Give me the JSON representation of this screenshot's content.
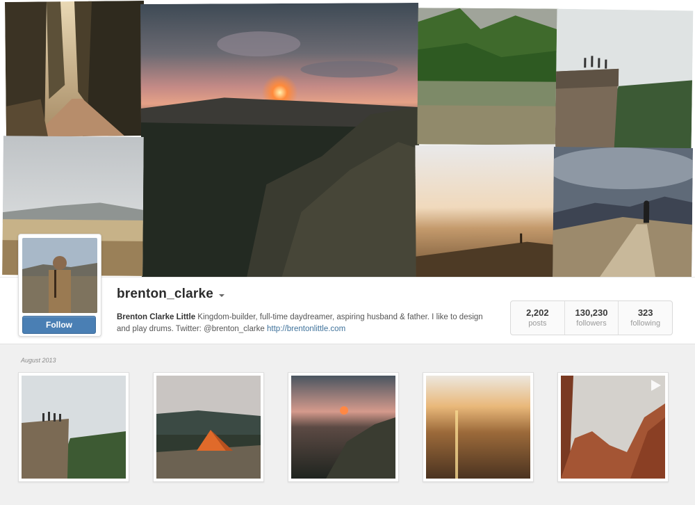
{
  "profile": {
    "username": "brenton_clarke",
    "full_name": "Brenton Clarke Little",
    "bio_text": " Kingdom-builder, full-time daydreamer, aspiring husband & father. I like to design and play drums. Twitter: @brenton_clarke ",
    "website": "http://brentonlittle.com",
    "follow_label": "Follow",
    "accent_color": "#4a7fb4",
    "link_color": "#3f729b"
  },
  "stats": [
    {
      "value": "2,202",
      "label": "posts"
    },
    {
      "value": "130,230",
      "label": "followers"
    },
    {
      "value": "323",
      "label": "following"
    }
  ],
  "feed": {
    "month": "August 2013",
    "items": [
      {
        "name": "cliff-group-photo",
        "is_video": false
      },
      {
        "name": "tent-photo",
        "is_video": false
      },
      {
        "name": "sunset-rock-photo",
        "is_video": false
      },
      {
        "name": "hazy-sunset-photo",
        "is_video": false
      },
      {
        "name": "red-rocks-video",
        "is_video": true
      }
    ]
  },
  "icons": {
    "dropdown": "chevron-down-icon",
    "video": "play-icon"
  }
}
